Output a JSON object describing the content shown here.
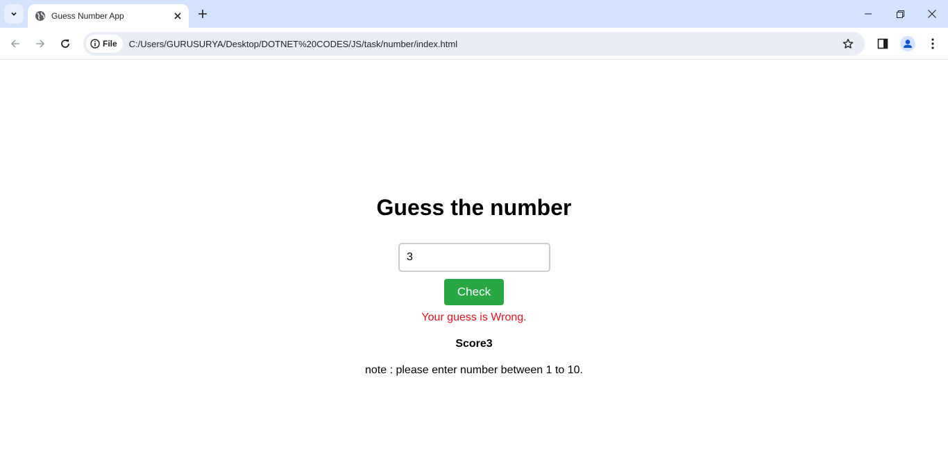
{
  "browser": {
    "tab_title": "Guess Number App",
    "new_tab_label": "+",
    "chip_label": "File",
    "url": "C:/Users/GURUSURYA/Desktop/DOTNET%20CODES/JS/task/number/index.html"
  },
  "page": {
    "heading": "Guess the number",
    "input_value": "3",
    "check_label": "Check",
    "result_message": "Your guess is Wrong.",
    "score_text": "Score3",
    "note": "note : please enter number between 1 to 10."
  },
  "colors": {
    "check_button": "#28a745",
    "error_text": "#e3141e"
  }
}
